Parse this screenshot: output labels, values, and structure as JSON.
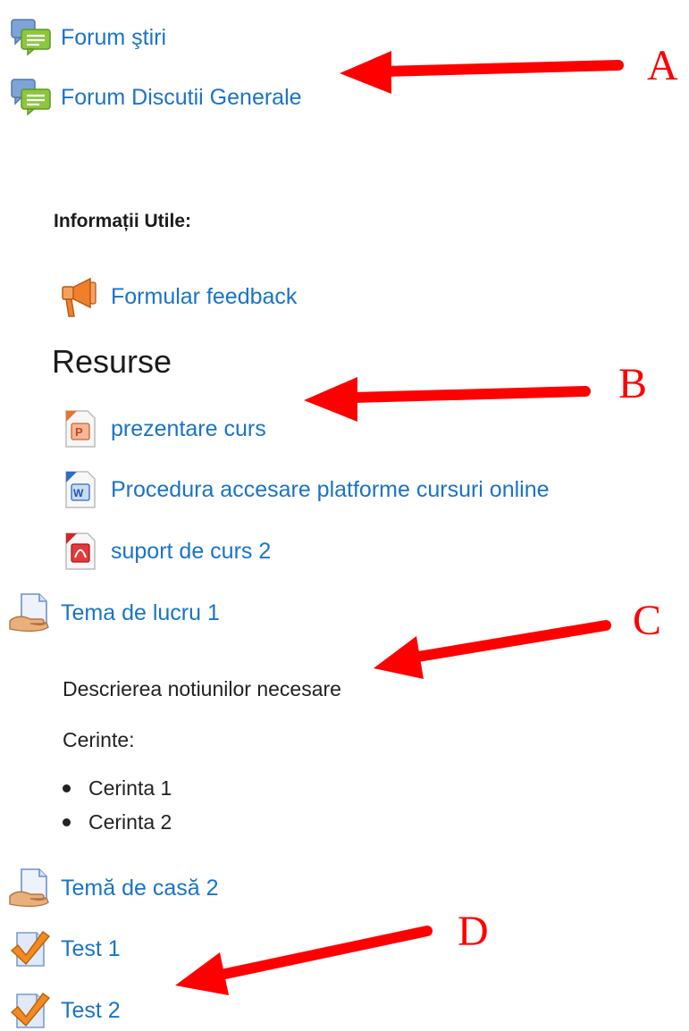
{
  "activities_top": [
    {
      "label": "Forum ştiri",
      "icon": "forum-icon"
    },
    {
      "label": "Forum Discutii Generale",
      "icon": "forum-icon"
    }
  ],
  "info": {
    "heading": "Informații Utile:",
    "feedback_label": "Formular feedback",
    "feedback_icon": "megaphone-icon"
  },
  "resources": {
    "title": "Resurse",
    "items": [
      {
        "label": "prezentare curs",
        "icon": "powerpoint-file-icon"
      },
      {
        "label": "Procedura accesare platforme cursuri online",
        "icon": "word-file-icon"
      },
      {
        "label": "suport de curs 2",
        "icon": "pdf-file-icon"
      }
    ]
  },
  "assignment1": {
    "label": "Tema de lucru 1",
    "icon": "assignment-icon",
    "description": "Descrierea notiunilor necesare",
    "requirements_label": "Cerinte:",
    "requirements": [
      "Cerinta 1",
      "Cerinta 2"
    ]
  },
  "assignment2": {
    "label": "Temă de casă 2",
    "icon": "assignment-icon"
  },
  "quizzes": [
    {
      "label": "Test 1",
      "icon": "quiz-icon"
    },
    {
      "label": "Test 2",
      "icon": "quiz-icon"
    }
  ],
  "annotations": {
    "a": "A",
    "b": "B",
    "c": "C",
    "d": "D"
  },
  "colors": {
    "link": "#1a73c7",
    "arrow": "#ff0000"
  }
}
